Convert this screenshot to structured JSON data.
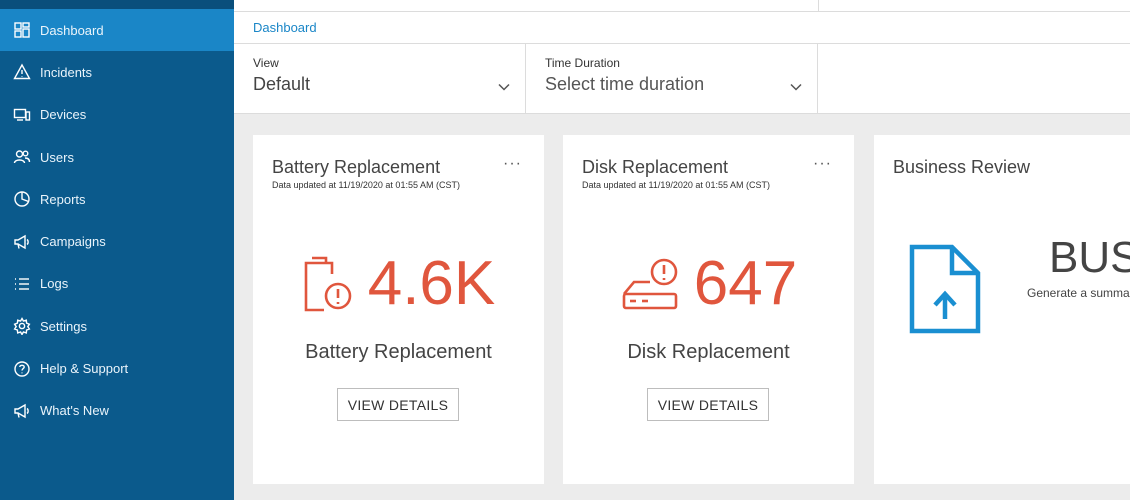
{
  "sidebar": {
    "items": [
      {
        "label": "Dashboard",
        "icon": "dashboard-icon",
        "active": true
      },
      {
        "label": "Incidents",
        "icon": "warning-icon"
      },
      {
        "label": "Devices",
        "icon": "devices-icon"
      },
      {
        "label": "Users",
        "icon": "users-icon"
      },
      {
        "label": "Reports",
        "icon": "pie-chart-icon"
      },
      {
        "label": "Campaigns",
        "icon": "megaphone-icon"
      },
      {
        "label": "Logs",
        "icon": "list-icon"
      },
      {
        "label": "Settings",
        "icon": "gear-icon"
      },
      {
        "label": "Help & Support",
        "icon": "help-icon"
      },
      {
        "label": "What's New",
        "icon": "megaphone-icon"
      }
    ]
  },
  "breadcrumb": "Dashboard",
  "filters": {
    "view": {
      "label": "View",
      "value": "Default"
    },
    "time": {
      "label": "Time Duration",
      "value": "Select time duration"
    }
  },
  "cards": [
    {
      "title": "Battery Replacement",
      "updated": "Data updated at 11/19/2020 at 01:55 AM (CST)",
      "value": "4.6K",
      "label": "Battery Replacement",
      "button": "VIEW DETAILS",
      "icon": "battery-alert-icon",
      "menu": "···"
    },
    {
      "title": "Disk Replacement",
      "updated": "Data updated at 11/19/2020 at 01:55 AM (CST)",
      "value": "647",
      "label": "Disk Replacement",
      "button": "VIEW DETAILS",
      "icon": "disk-alert-icon",
      "menu": "···"
    },
    {
      "title": "Business Review",
      "headline": "BUS",
      "description": "Generate a summa",
      "icon": "document-upload-icon"
    }
  ],
  "colors": {
    "sidebar": "#0b5a8c",
    "sidebar_active": "#1a86c7",
    "accent": "#1a86c7",
    "alert": "#e0563d",
    "doc_icon": "#1a8fd1"
  }
}
